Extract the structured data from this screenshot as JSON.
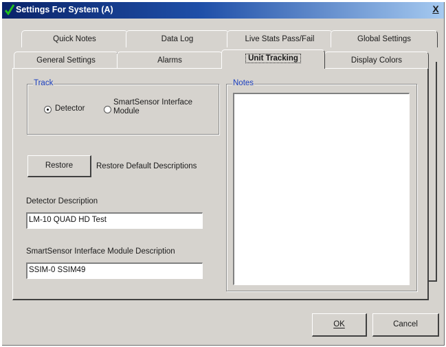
{
  "window": {
    "title": "Settings For System (A)",
    "close_label": "X"
  },
  "tabs_back": [
    "Quick Notes",
    "Data Log",
    "Live Stats Pass/Fail",
    "Global Settings"
  ],
  "tabs_front": [
    "General Settings",
    "Alarms",
    "Unit Tracking",
    "Display Colors"
  ],
  "active_tab": "Unit Tracking",
  "track": {
    "legend": "Track",
    "options": [
      "Detector",
      "SmartSensor Interface Module"
    ],
    "selected": "Detector"
  },
  "restore": {
    "button_label": "Restore",
    "description": "Restore Default Descriptions"
  },
  "detector": {
    "label": "Detector Description",
    "value": "LM-10 QUAD HD Test"
  },
  "ssim": {
    "label": "SmartSensor Interface  Module Description",
    "value": "SSIM-0 SSIM49"
  },
  "notes": {
    "legend": "Notes",
    "value": ""
  },
  "footer": {
    "ok_label": "OK",
    "cancel_label": "Cancel"
  },
  "colors": {
    "accent": "#1b3fc0",
    "titlebar": "#0a246a",
    "face": "#d6d3ce"
  }
}
